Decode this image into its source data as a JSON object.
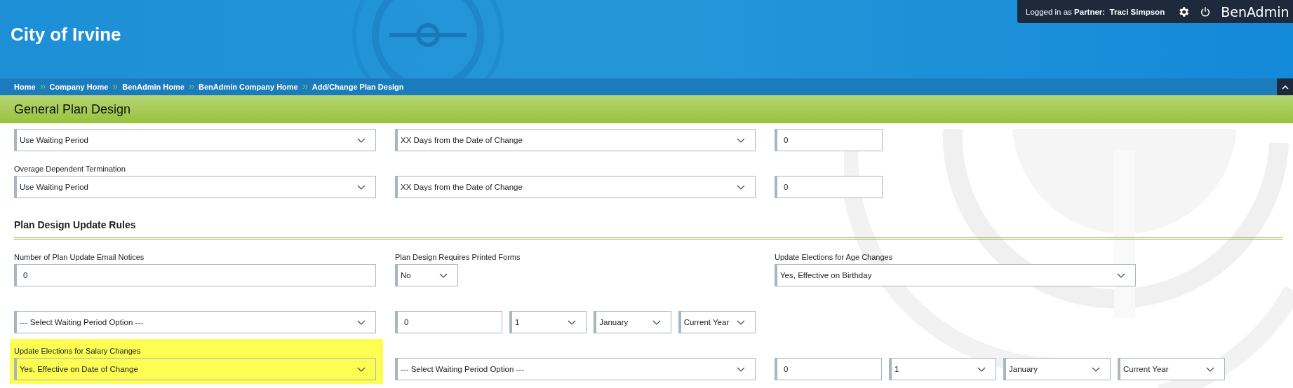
{
  "header": {
    "title": "City of Irvine"
  },
  "user_bar": {
    "prefix": "Logged in as",
    "role": "Partner:",
    "name": "Traci Simpson",
    "brand": "BenAdmin"
  },
  "breadcrumb": [
    "Home",
    "Company Home",
    "BenAdmin Home",
    "BenAdmin Company Home",
    "Add/Change Plan Design"
  ],
  "page_title": "General Plan Design",
  "rows": [
    {
      "groups": [
        {
          "fields": [
            {
              "kind": "select",
              "value": "Use Waiting Period"
            }
          ]
        },
        {
          "fields": [
            {
              "kind": "select",
              "value": "XX Days from the Date of Change"
            }
          ]
        },
        {
          "fields": [
            {
              "kind": "input",
              "value": "0"
            }
          ]
        }
      ]
    },
    {
      "groups": [
        {
          "label": "Overage Dependent Termination",
          "fields": [
            {
              "kind": "select",
              "value": "Use Waiting Period"
            }
          ]
        },
        {
          "fields": [
            {
              "kind": "select",
              "value": "XX Days from the Date of Change"
            }
          ]
        },
        {
          "fields": [
            {
              "kind": "input",
              "value": "0"
            }
          ]
        }
      ]
    },
    {
      "heading": "Plan Design Update Rules",
      "groups": [
        {
          "label": "Number of Plan Update Email Notices",
          "fields": [
            {
              "kind": "input",
              "value": "0"
            }
          ]
        },
        {
          "label": "Plan Design Requires Printed Forms",
          "fields": [
            {
              "kind": "select",
              "value": "No"
            }
          ]
        },
        {
          "label": "Update Elections for Age Changes",
          "fields": [
            {
              "kind": "select",
              "value": "Yes, Effective on Birthday"
            }
          ]
        }
      ]
    },
    {
      "groups": [
        {
          "fields": [
            {
              "kind": "select",
              "value": "--- Select Waiting Period Option ---"
            }
          ]
        },
        {
          "fields": [
            {
              "kind": "input",
              "value": "0"
            },
            {
              "kind": "select",
              "value": "1"
            },
            {
              "kind": "select",
              "value": "January"
            },
            {
              "kind": "select",
              "value": "Current Year"
            }
          ]
        }
      ]
    },
    {
      "highlighted": true,
      "groups": [
        {
          "label": "Update Elections for Salary Changes",
          "fields": [
            {
              "kind": "select",
              "value": "Yes, Effective on Date of Change"
            }
          ]
        },
        {
          "fields": [
            {
              "kind": "select",
              "value": "--- Select Waiting Period Option ---"
            }
          ]
        },
        {
          "fields": [
            {
              "kind": "input",
              "value": "0"
            },
            {
              "kind": "select",
              "value": "1"
            },
            {
              "kind": "select",
              "value": "January"
            },
            {
              "kind": "select",
              "value": "Current Year"
            }
          ]
        }
      ]
    }
  ]
}
